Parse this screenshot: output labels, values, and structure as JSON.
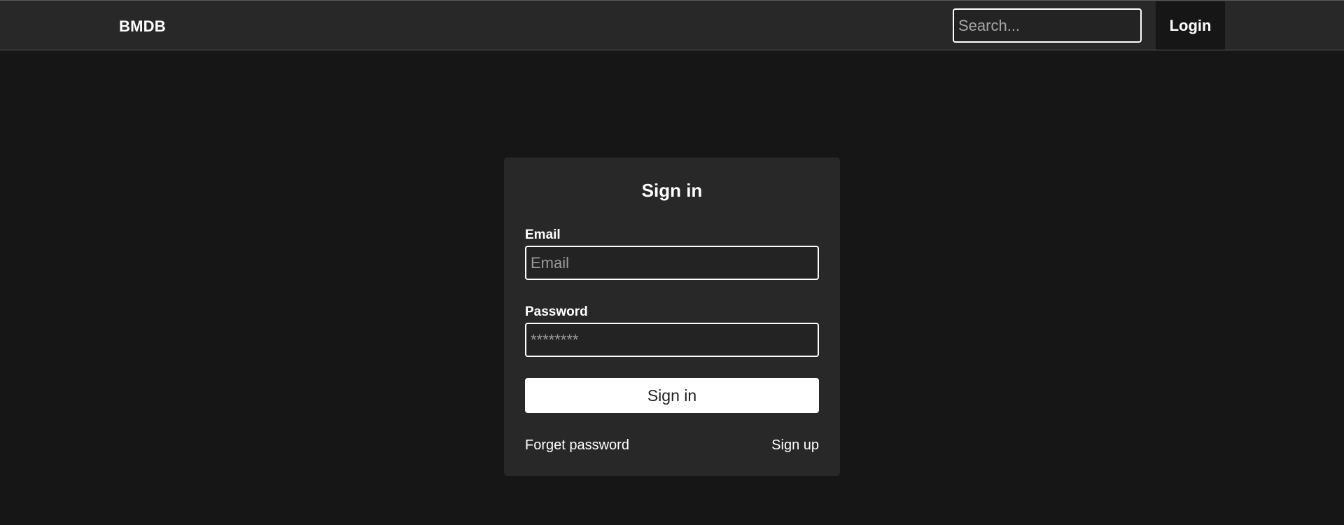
{
  "navbar": {
    "brand": "BMDB",
    "search_placeholder": "Search...",
    "login_label": "Login"
  },
  "signin_card": {
    "title": "Sign in",
    "email_label": "Email",
    "email_placeholder": "Email",
    "password_label": "Password",
    "password_placeholder": "********",
    "submit_label": "Sign in",
    "forget_password_label": "Forget password",
    "sign_up_label": "Sign up"
  },
  "colors": {
    "page_background": "#161616",
    "navbar_background": "#282828",
    "card_background": "#282828",
    "primary_button": "#ffffff",
    "text": "#ffffff"
  }
}
